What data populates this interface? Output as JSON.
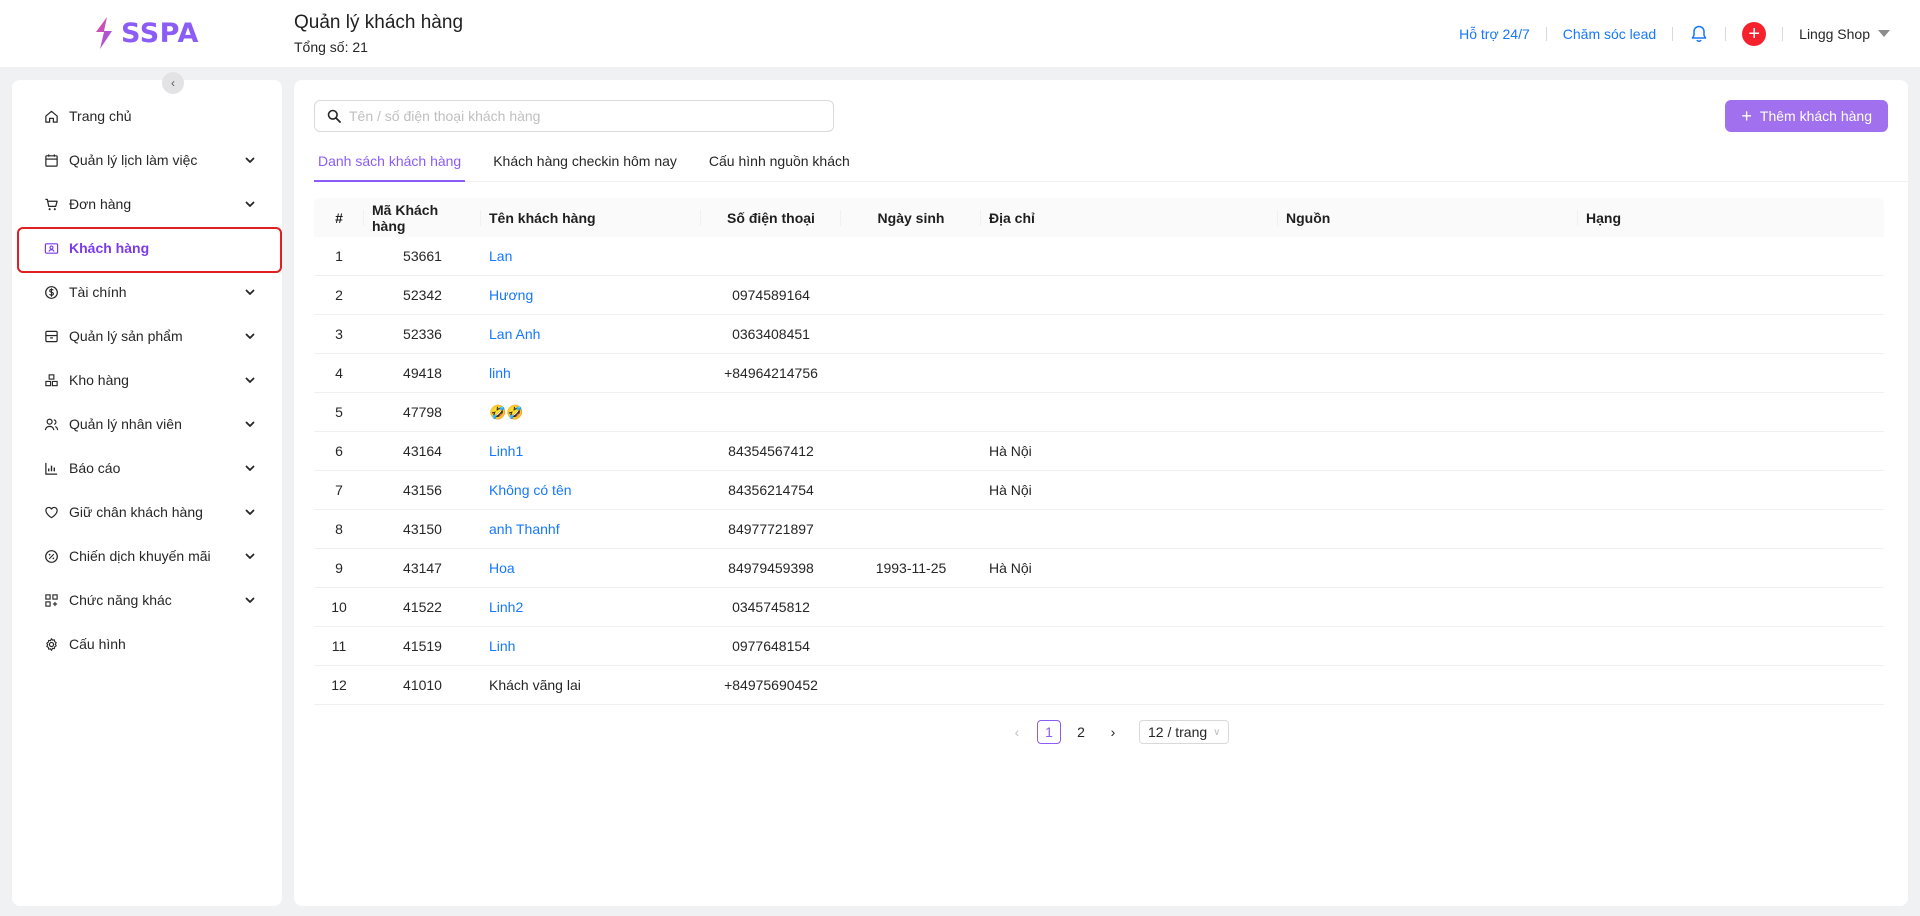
{
  "brand": {
    "name": "SSPA",
    "accent": "#8b5cf6"
  },
  "header": {
    "title": "Quản lý khách hàng",
    "subtitle": "Tổng số: 21",
    "support_link": "Hỗ trợ 24/7",
    "lead_link": "Chăm sóc lead",
    "bell_icon": "bell-icon",
    "add_icon": "plus-circle-icon",
    "shop_name": "Lingg Shop"
  },
  "sidebar": {
    "collapse_icon": "chevron-left-icon",
    "items": [
      {
        "label": "Trang chủ",
        "icon": "home-icon",
        "expandable": false
      },
      {
        "label": "Quản lý lịch làm việc",
        "icon": "calendar-icon",
        "expandable": true
      },
      {
        "label": "Đơn hàng",
        "icon": "cart-icon",
        "expandable": true
      },
      {
        "label": "Khách hàng",
        "icon": "contact-card-icon",
        "expandable": false,
        "active": true
      },
      {
        "label": "Tài chính",
        "icon": "dollar-icon",
        "expandable": true
      },
      {
        "label": "Quản lý sản phẩm",
        "icon": "box-icon",
        "expandable": true
      },
      {
        "label": "Kho hàng",
        "icon": "warehouse-icon",
        "expandable": true
      },
      {
        "label": "Quản lý nhân viên",
        "icon": "users-icon",
        "expandable": true
      },
      {
        "label": "Báo cáo",
        "icon": "chart-icon",
        "expandable": true
      },
      {
        "label": "Giữ chân khách hàng",
        "icon": "heart-icon",
        "expandable": true
      },
      {
        "label": "Chiến dịch khuyến mãi",
        "icon": "discount-icon",
        "expandable": true
      },
      {
        "label": "Chức năng khác",
        "icon": "apps-icon",
        "expandable": true
      },
      {
        "label": "Cấu hình",
        "icon": "gear-icon",
        "expandable": false
      }
    ]
  },
  "main": {
    "search": {
      "placeholder": "Tên / số điện thoại khách hàng",
      "value": ""
    },
    "add_button": "Thêm khách hàng",
    "tabs": [
      {
        "label": "Danh sách khách hàng",
        "active": true
      },
      {
        "label": "Khách hàng checkin hôm nay",
        "active": false
      },
      {
        "label": "Cấu hình nguồn khách",
        "active": false
      }
    ],
    "table": {
      "columns": [
        "#",
        "Mã Khách hàng",
        "Tên khách hàng",
        "Số điện thoại",
        "Ngày sinh",
        "Địa chỉ",
        "Nguồn",
        "Hạng"
      ],
      "rows": [
        {
          "idx": "1",
          "code": "53661",
          "name": "Lan",
          "name_link": true,
          "phone": "",
          "dob": "",
          "address": "",
          "source": "",
          "rank": ""
        },
        {
          "idx": "2",
          "code": "52342",
          "name": "Hương",
          "name_link": true,
          "phone": "0974589164",
          "dob": "",
          "address": "",
          "source": "",
          "rank": ""
        },
        {
          "idx": "3",
          "code": "52336",
          "name": "Lan Anh",
          "name_link": true,
          "phone": "0363408451",
          "dob": "",
          "address": "",
          "source": "",
          "rank": ""
        },
        {
          "idx": "4",
          "code": "49418",
          "name": "linh",
          "name_link": true,
          "phone": "+84964214756",
          "dob": "",
          "address": "",
          "source": "",
          "rank": ""
        },
        {
          "idx": "5",
          "code": "47798",
          "name": "🤣🤣",
          "name_link": false,
          "phone": "",
          "dob": "",
          "address": "",
          "source": "",
          "rank": ""
        },
        {
          "idx": "6",
          "code": "43164",
          "name": "Linh1",
          "name_link": true,
          "phone": "84354567412",
          "dob": "",
          "address": "Hà Nội",
          "source": "",
          "rank": ""
        },
        {
          "idx": "7",
          "code": "43156",
          "name": "Không có tên",
          "name_link": true,
          "phone": "84356214754",
          "dob": "",
          "address": "Hà Nội",
          "source": "",
          "rank": ""
        },
        {
          "idx": "8",
          "code": "43150",
          "name": "anh Thanhf",
          "name_link": true,
          "phone": "84977721897",
          "dob": "",
          "address": "",
          "source": "",
          "rank": ""
        },
        {
          "idx": "9",
          "code": "43147",
          "name": "Hoa",
          "name_link": true,
          "phone": "84979459398",
          "dob": "1993-11-25",
          "address": "Hà Nội",
          "source": "",
          "rank": ""
        },
        {
          "idx": "10",
          "code": "41522",
          "name": "Linh2",
          "name_link": true,
          "phone": "0345745812",
          "dob": "",
          "address": "",
          "source": "",
          "rank": ""
        },
        {
          "idx": "11",
          "code": "41519",
          "name": "Linh",
          "name_link": true,
          "phone": "0977648154",
          "dob": "",
          "address": "",
          "source": "",
          "rank": ""
        },
        {
          "idx": "12",
          "code": "41010",
          "name": "Khách vãng lai",
          "name_link": false,
          "phone": "+84975690452",
          "dob": "",
          "address": "",
          "source": "",
          "rank": ""
        }
      ]
    },
    "pagination": {
      "pages": [
        "1",
        "2"
      ],
      "current": "1",
      "page_size": "12 / trang"
    }
  }
}
